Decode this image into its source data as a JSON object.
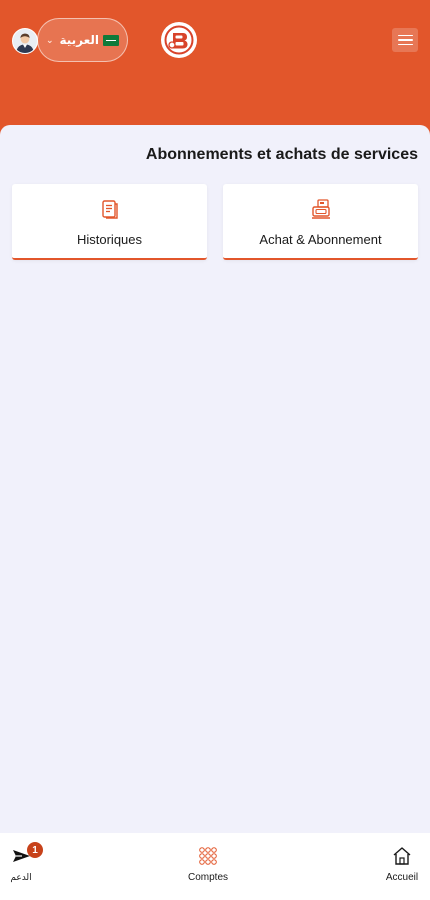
{
  "header": {
    "language": {
      "label": "العربية",
      "flag_icon": "saudi-flag-icon",
      "chevron_icon": "chevron-down-icon"
    },
    "avatar_icon": "user-avatar-icon",
    "logo_icon": "brand-logo-icon",
    "menu_icon": "hamburger-menu-icon"
  },
  "main": {
    "title": "Abonnements et achats de services",
    "cards": [
      {
        "label": "Historiques",
        "icon": "receipt-list-icon"
      },
      {
        "label": "Achat & Abonnement",
        "icon": "cash-register-icon"
      }
    ]
  },
  "bottom_nav": {
    "items": [
      {
        "label": "الدعم",
        "icon": "send-icon",
        "badge": "1"
      },
      {
        "label": "Comptes",
        "icon": "grid-dots-icon"
      },
      {
        "label": "Accueil",
        "icon": "home-icon"
      }
    ]
  },
  "colors": {
    "accent": "#e2562b",
    "background": "#f1f1fb",
    "badge": "#c7421a"
  }
}
